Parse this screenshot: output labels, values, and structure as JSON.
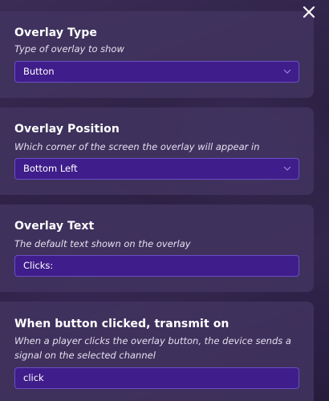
{
  "close": {
    "icon": "close-icon"
  },
  "panels": [
    {
      "title": "Overlay Type",
      "description": "Type of overlay to show",
      "value": "Button",
      "control": "dropdown"
    },
    {
      "title": "Overlay Position",
      "description": "Which corner of the screen the overlay will appear in",
      "value": "Bottom Left",
      "control": "dropdown"
    },
    {
      "title": "Overlay Text",
      "description": "The default text shown on the overlay",
      "value": "Clicks:",
      "control": "text-input"
    },
    {
      "title": "When button clicked, transmit on",
      "description": "When a player clicks the overlay button, the device sends a signal on the selected channel",
      "value": "click",
      "control": "text-input"
    }
  ],
  "colors": {
    "field_bg": "#3f1d8a",
    "field_border": "#6b4fc4",
    "panel_bg": "#423460"
  }
}
